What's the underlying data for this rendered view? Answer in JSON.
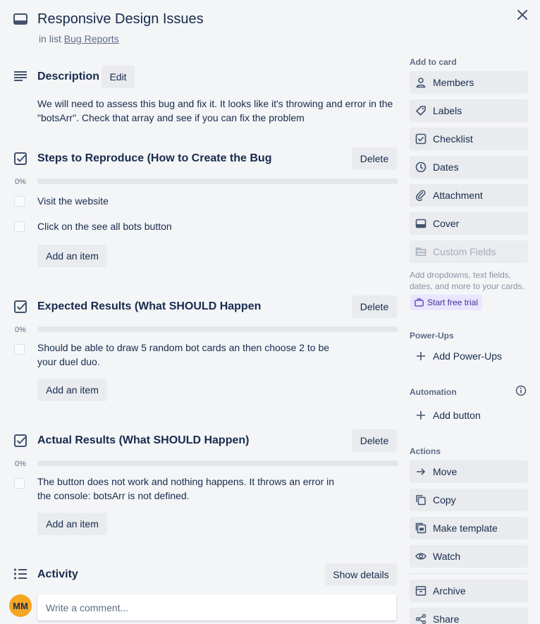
{
  "card": {
    "title": "Responsive Design Issues",
    "in_list_prefix": "in list",
    "list_name": "Bug Reports",
    "close_icon": "close-icon"
  },
  "description": {
    "heading": "Description",
    "edit_label": "Edit",
    "text": "We will need to assess this bug and fix it. It looks like it's throwing and error in the \"botsArr\". Check that array and see if you can fix the problem"
  },
  "checklists": [
    {
      "title": "Steps to Reproduce (How to Create the Bug",
      "delete_label": "Delete",
      "percent": "0%",
      "progress": 0,
      "items": [
        "Visit the website",
        "Click on the see all bots button"
      ],
      "add_label": "Add an item"
    },
    {
      "title": "Expected Results (What SHOULD Happen",
      "delete_label": "Delete",
      "percent": "0%",
      "progress": 0,
      "items": [
        "Should be able to draw 5 random bot cards an then choose 2 to be your duel duo."
      ],
      "add_label": "Add an item"
    },
    {
      "title": "Actual Results (What SHOULD Happen)",
      "delete_label": "Delete",
      "percent": "0%",
      "progress": 0,
      "items": [
        "The button does not work and nothing happens. It throws an error in the console: botsArr is not defined."
      ],
      "add_label": "Add an item"
    }
  ],
  "activity": {
    "heading": "Activity",
    "show_details_label": "Show details",
    "avatar_initials": "MM",
    "comment_placeholder": "Write a comment..."
  },
  "sidebar": {
    "add_to_card": {
      "label": "Add to card",
      "buttons": [
        "Members",
        "Labels",
        "Checklist",
        "Dates",
        "Attachment",
        "Cover",
        "Custom Fields"
      ],
      "help_text": "Add dropdowns, text fields, dates, and more to your cards.",
      "trial_label": "Start free trial"
    },
    "power_ups": {
      "label": "Power-Ups",
      "add_label": "Add Power-Ups"
    },
    "automation": {
      "label": "Automation",
      "add_label": "Add button"
    },
    "actions": {
      "label": "Actions",
      "buttons": [
        "Move",
        "Copy",
        "Make template",
        "Watch",
        "Archive",
        "Share"
      ]
    }
  },
  "colors": {
    "background": "#f4f5f7",
    "button": "#e9ebee",
    "text": "#172b4d",
    "muted": "#5e6c84",
    "avatar": "#f5a623",
    "trial_bg": "#eae6ff",
    "trial_text": "#403294"
  }
}
